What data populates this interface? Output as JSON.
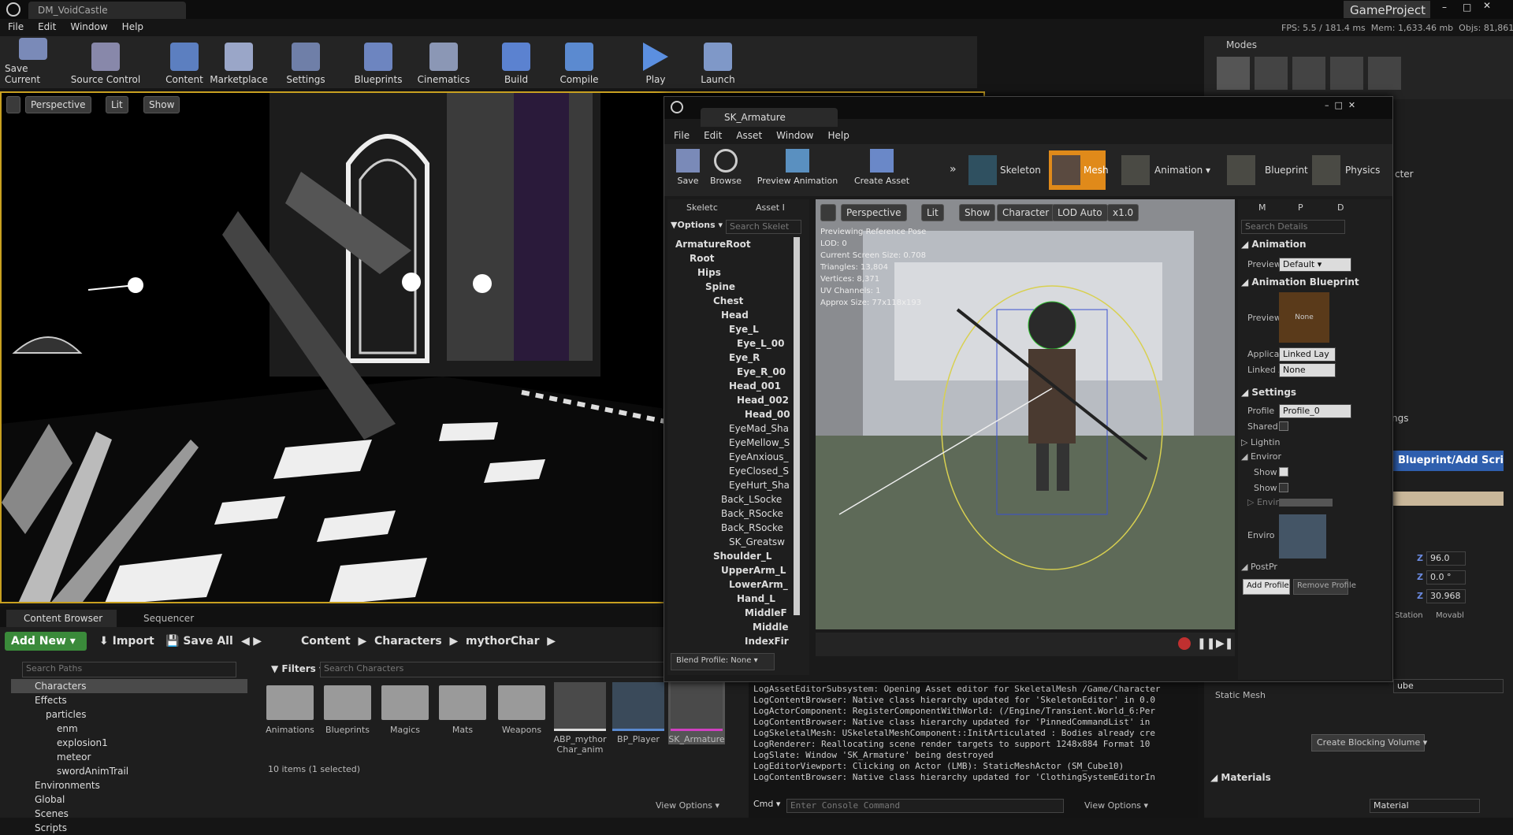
{
  "main_window": {
    "tab_title": "DM_VoidCastle",
    "project": "GameProject",
    "menu": [
      "File",
      "Edit",
      "Window",
      "Help"
    ],
    "stats": {
      "fps_label": "FPS:",
      "fps": "5.5",
      "ms": "/ 181.4 ms",
      "mem_label": "Mem:",
      "mem": "1,633.46 mb",
      "objs_label": "Objs:",
      "objs": "81,861"
    }
  },
  "toolbar": [
    {
      "label": "Save Current",
      "icon": "save-icon"
    },
    {
      "label": "Source Control",
      "icon": "source-control-icon"
    },
    {
      "label": "Content",
      "icon": "content-icon"
    },
    {
      "label": "Marketplace",
      "icon": "marketplace-icon"
    },
    {
      "label": "Settings",
      "icon": "settings-icon"
    },
    {
      "label": "Blueprints",
      "icon": "blueprints-icon"
    },
    {
      "label": "Cinematics",
      "icon": "cinematics-icon"
    },
    {
      "label": "Build",
      "icon": "build-icon"
    },
    {
      "label": "Compile",
      "icon": "compile-icon"
    },
    {
      "label": "Play",
      "icon": "play-icon"
    },
    {
      "label": "Launch",
      "icon": "launch-icon"
    }
  ],
  "viewport": {
    "perspective": "Perspective",
    "lit": "Lit",
    "show": "Show"
  },
  "modes": {
    "title": "Modes"
  },
  "content_browser": {
    "tab": "Content Browser",
    "tab2": "Sequencer",
    "add_new": "Add New",
    "import": "Import",
    "save_all": "Save All",
    "breadcrumb": [
      "Content",
      "Characters",
      "mythorChar"
    ],
    "search_paths": "Search Paths",
    "filters": "Filters",
    "search_chars": "Search Characters",
    "folders": [
      "Characters",
      "Effects",
      "particles",
      "enm",
      "explosion1",
      "meteor",
      "swordAnimTrail",
      "Environments",
      "Global",
      "Scenes",
      "Scripts"
    ],
    "assets": [
      "Animations",
      "Blueprints",
      "Magics",
      "Mats",
      "Weapons",
      "ABP_mythor Char_anim",
      "BP_Player",
      "SK_Armature"
    ],
    "status": "10 items (1 selected)",
    "view_options": "View Options"
  },
  "editor": {
    "tab": "SK_Armature",
    "menu": [
      "File",
      "Edit",
      "Asset",
      "Window",
      "Help"
    ],
    "tools": [
      "Save",
      "Browse",
      "Preview Animation",
      "Create Asset"
    ],
    "modes": [
      "Skeleton",
      "Mesh",
      "Animation",
      "Blueprint",
      "Physics"
    ],
    "left_tabs": [
      "Skeletc",
      "Asset I"
    ],
    "options": "Options",
    "search_skel": "Search Skelet",
    "bones": [
      "ArmatureRoot",
      "Root",
      "Hips",
      "Spine",
      "Chest",
      "Head",
      "Eye_L",
      "Eye_L_00",
      "Eye_R",
      "Eye_R_00",
      "Head_001",
      "Head_002",
      "Head_00",
      "EyeMad_Sha",
      "EyeMellow_S",
      "EyeAnxious_",
      "EyeClosed_S",
      "EyeHurt_Sha",
      "Back_LSocke",
      "Back_RSocke",
      "Back_RSocke",
      "SK_Greatsw",
      "Shoulder_L",
      "UpperArm_L",
      "LowerArm_",
      "Hand_L",
      "MiddleF",
      "Middle",
      "IndexFir"
    ],
    "blend_profile": "Blend Profile: None",
    "vp": {
      "perspective": "Perspective",
      "lit": "Lit",
      "show": "Show",
      "character": "Character",
      "lod": "LOD Auto",
      "speed": "x1.0"
    },
    "info": [
      "Previewing Reference Pose",
      "LOD: 0",
      "Current Screen Size: 0.708",
      "Triangles: 13,804",
      "Vertices: 8,371",
      "UV Channels: 1",
      "Approx Size: 77x118x193"
    ],
    "details": {
      "tabs": [
        "M",
        "P",
        "D"
      ],
      "search": "Search Details",
      "animation": "Animation",
      "preview_label": "Preview",
      "preview_val": "Default",
      "anim_bp": "Animation Blueprint",
      "preview2": "Preview",
      "none_thumb": "None",
      "applic": "Applicat",
      "applic_val": "Linked Lay",
      "linked": "Linked A",
      "linked_val": "None",
      "settings": "Settings",
      "profile": "Profile",
      "profile_val": "Profile_0",
      "shared": "Shared",
      "lighting": "Lightin",
      "environ": "Enviror",
      "show1": "Show",
      "show2": "Show",
      "envir": "Envir",
      "envir2": "Enviro",
      "postpr": "PostPr",
      "add_profile": "Add Profile",
      "remove_profile": "Remove Profile"
    }
  },
  "log": [
    "LogAssetEditorSubsystem: Opening Asset editor for SkeletalMesh /Game/Character",
    "LogContentBrowser: Native class hierarchy updated for 'SkeletonEditor' in 0.0",
    "LogActorComponent: RegisterComponentWithWorld: (/Engine/Transient.World_6:Per",
    "LogContentBrowser: Native class hierarchy updated for 'PinnedCommandList' in",
    "LogSkeletalMesh: USkeletalMeshComponent::InitArticulated : Bodies already cre",
    "LogRenderer: Reallocating scene render targets to support 1248x884 Format 10",
    "LogSlate: Window 'SK_Armature' being destroyed",
    "LogEditorViewport: Clicking on Actor (LMB): StaticMeshActor (SM_Cube10)",
    "LogContentBrowser: Native class hierarchy updated for 'ClothingSystemEditorIn"
  ],
  "cmd": {
    "label": "Cmd",
    "placeholder": "Enter Console Command",
    "view_options": "View Options"
  },
  "right": {
    "ter": "cter",
    "ngs": "ngs",
    "bp_script": "Blueprint/Add Script",
    "v1": "96.0",
    "v2": "0.0 °",
    "v3": "30.968",
    "z": "Z",
    "station": "Station",
    "movable": "Movabl",
    "static_mesh": "Static Mesh",
    "ube": "ube",
    "create_blocking": "Create Blocking Volume",
    "materials": "Materials",
    "material": "Material"
  }
}
